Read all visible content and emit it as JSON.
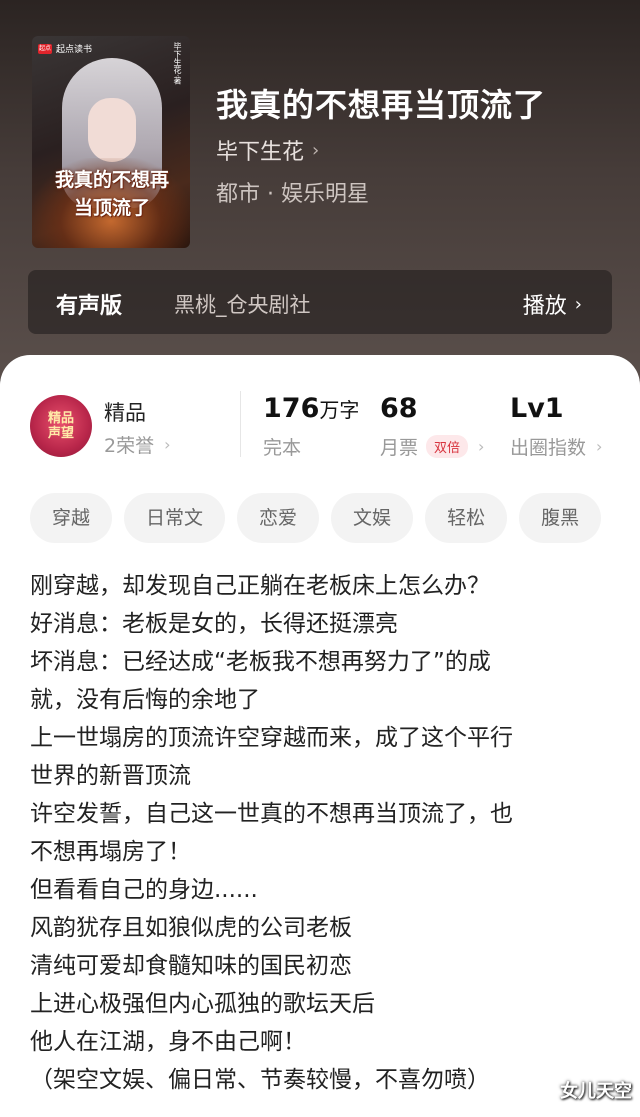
{
  "cover": {
    "publisher": "起点读书",
    "publisher_logo": "起点",
    "author_vertical": "毕下生花·著",
    "title_line1": "我真的不想再",
    "title_line2": "当顶流了"
  },
  "book": {
    "title": "我真的不想再当顶流了",
    "author": "毕下生花",
    "category": "都市 · 娱乐明星"
  },
  "audio": {
    "label": "有声版",
    "studio": "黑桃_仓央剧社",
    "play": "播放"
  },
  "badge": {
    "icon_text": "精品\n声望",
    "title": "精品",
    "sub": "2荣誉"
  },
  "stats": {
    "words_value": "176",
    "words_unit": "万字",
    "words_sub": "完本",
    "tickets_value": "68",
    "tickets_sub": "月票",
    "tickets_tag": "双倍",
    "level_value": "Lv1",
    "level_sub": "出圈指数"
  },
  "tags": [
    "穿越",
    "日常文",
    "恋爱",
    "文娱",
    "轻松",
    "腹黑"
  ],
  "description": [
    "刚穿越，却发现自己正躺在老板床上怎么办？",
    "好消息：老板是女的，长得还挺漂亮",
    "坏消息：已经达成“老板我不想再努力了”的成",
    "就，没有后悔的余地了",
    "上一世塌房的顶流许空穿越而来，成了这个平行",
    "世界的新晋顶流",
    "许空发誓，自己这一世真的不想再当顶流了，也",
    "不想再塌房了！",
    "但看看自己的身边......",
    "风韵犹存且如狼似虎的公司老板",
    "清纯可爱却食髓知味的国民初恋",
    "上进心极强但内心孤独的歌坛天后",
    "他人在江湖，身不由己啊！",
    "（架空文娱、偏日常、节奏较慢，不喜勿喷）"
  ],
  "watermark": "女儿天空",
  "icons": {
    "chevron": "›"
  }
}
